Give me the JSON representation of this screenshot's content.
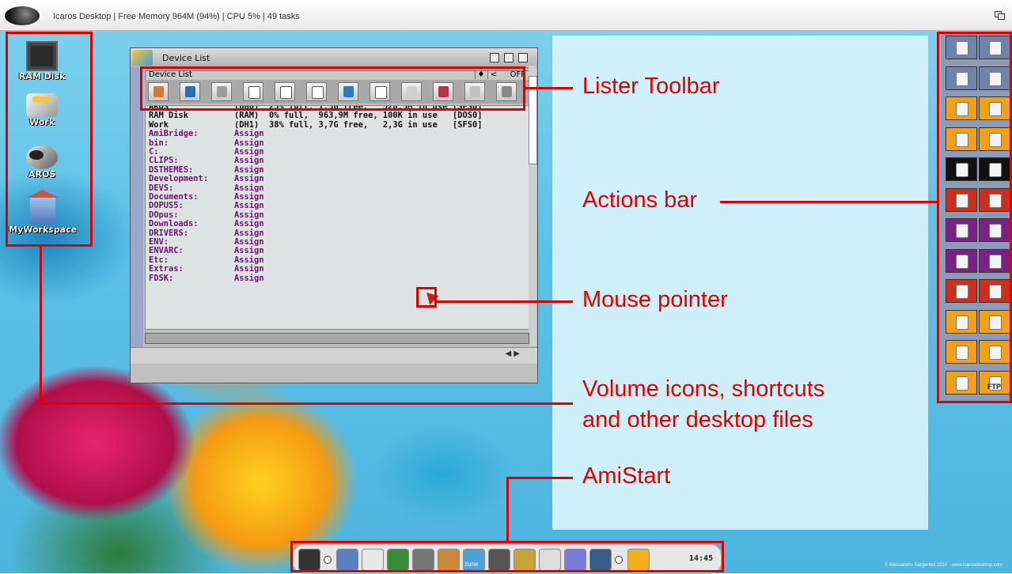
{
  "topbar": {
    "title": "Icaros Desktop | Free Memory 964M (94%) | CPU 5% | 49 tasks"
  },
  "desktop_icons": [
    {
      "label": "RAM Disk",
      "icon": "ram-chip-icon"
    },
    {
      "label": "Work",
      "icon": "work-drive-icon"
    },
    {
      "label": "AROS",
      "icon": "aros-drive-icon"
    },
    {
      "label": "MyWorkspace",
      "icon": "workspace-house-icon"
    }
  ],
  "lister": {
    "title": "Device List",
    "path": "Device List",
    "path_buttons": [
      "♦",
      "<"
    ],
    "off_label": "OFF",
    "toolbar_icons": [
      "home-icon",
      "cube-icon",
      "cube-grey-icon",
      "doc-arrow-icon",
      "copy-icon",
      "new-doc-icon",
      "trash-icon",
      "paste-icon",
      "lock-icon",
      "view-icon",
      "eject-icon",
      "run-icon"
    ],
    "rows": [
      {
        "name": "AROS",
        "dev": "(DH0)",
        "info": "25% full, 1,5G free,   528,5M in use",
        "fs": "[SFS0]",
        "kind": "vol"
      },
      {
        "name": "RAM Disk",
        "dev": "(RAM)",
        "info": "0% full,  963,9M free, 100K in use",
        "fs": "[DOS0]",
        "kind": "vol"
      },
      {
        "name": "Work",
        "dev": "(DH1)",
        "info": "38% full, 3,7G free,   2,3G in use",
        "fs": "[SFS0]",
        "kind": "vol"
      },
      {
        "name": "AmiBridge:",
        "dev": "Assign",
        "kind": "asg"
      },
      {
        "name": "bin:",
        "dev": "Assign",
        "kind": "asg"
      },
      {
        "name": "C:",
        "dev": "Assign",
        "kind": "asg"
      },
      {
        "name": "CLIPS:",
        "dev": "Assign",
        "kind": "asg"
      },
      {
        "name": "DSTHEMES:",
        "dev": "Assign",
        "kind": "asg"
      },
      {
        "name": "Development:",
        "dev": "Assign",
        "kind": "asg"
      },
      {
        "name": "DEVS:",
        "dev": "Assign",
        "kind": "asg"
      },
      {
        "name": "Documents:",
        "dev": "Assign",
        "kind": "asg"
      },
      {
        "name": "DOPUS5:",
        "dev": "Assign",
        "kind": "asg"
      },
      {
        "name": "DOpus:",
        "dev": "Assign",
        "kind": "asg"
      },
      {
        "name": "Downloads:",
        "dev": "Assign",
        "kind": "asg"
      },
      {
        "name": "DRIVERS:",
        "dev": "Assign",
        "kind": "asg"
      },
      {
        "name": "ENV:",
        "dev": "Assign",
        "kind": "asg"
      },
      {
        "name": "ENVARC:",
        "dev": "Assign",
        "kind": "asg"
      },
      {
        "name": "Etc:",
        "dev": "Assign",
        "kind": "asg"
      },
      {
        "name": "Extras:",
        "dev": "Assign",
        "kind": "asg"
      },
      {
        "name": "FDSK:",
        "dev": "Assign",
        "kind": "asg"
      }
    ]
  },
  "callouts": {
    "lister_toolbar": "Lister Toolbar",
    "actions_bar": "Actions bar",
    "mouse_pointer": "Mouse pointer",
    "volume_icons_1": "Volume icons, shortcuts",
    "volume_icons_2": "and other desktop files",
    "amistart": "AmiStart"
  },
  "actions_bar": {
    "rows": [
      {
        "color": "#6f84ad",
        "icons": [
          "copy-icon",
          "copy-icon"
        ]
      },
      {
        "color": "#6f84ad",
        "icons": [
          "cube-icon",
          "home-icon"
        ]
      },
      {
        "color": "#f3a019",
        "icons": [
          "lock-icon",
          "arrow-folder-icon"
        ]
      },
      {
        "color": "#f3a019",
        "icons": [
          "run-icon",
          "doc-arrow-icon"
        ]
      },
      {
        "color": "#111111",
        "icons": [
          "camera-icon",
          "search-icon"
        ]
      },
      {
        "color": "#c9311c",
        "icons": [
          "trash-icon",
          "cube-grey-icon"
        ]
      },
      {
        "color": "#7a2185",
        "icons": [
          "new-doc-icon",
          "copy-icon"
        ]
      },
      {
        "color": "#7a2185",
        "icons": [
          "list-icon",
          "copy-icon"
        ]
      },
      {
        "color": "#c9311c",
        "icons": [
          "note-icon",
          "box-icon"
        ]
      },
      {
        "color": "#f3a019",
        "icons": [
          "split-icon",
          "doc-icon"
        ]
      },
      {
        "color": "#f3a019",
        "icons": [
          "doc-arrow-icon",
          "note-icon"
        ]
      },
      {
        "color": "#f3a019",
        "icons": [
          "run-icon",
          "ftp-icon"
        ]
      }
    ],
    "ftp_label": "FTP"
  },
  "amistart": {
    "icons": [
      "aros-logo-icon",
      "dot",
      "box-icon",
      "compass-icon",
      "book-icon",
      "drive-icon",
      "paint-icon",
      "zune-icon",
      "pan-icon",
      "wordpress-icon",
      "notes-icon",
      "gear-icon",
      "butterfly-icon",
      "dot",
      "monitor-icon"
    ],
    "zune_label": "zune",
    "clock": "14:45"
  },
  "credit": "© Alessandro Sargentini 2010 · www.icarosdesktop.com",
  "colors": {
    "callout_red": "#e00000",
    "assign_purple": "#6b126b",
    "actions_orange": "#f3a019"
  }
}
